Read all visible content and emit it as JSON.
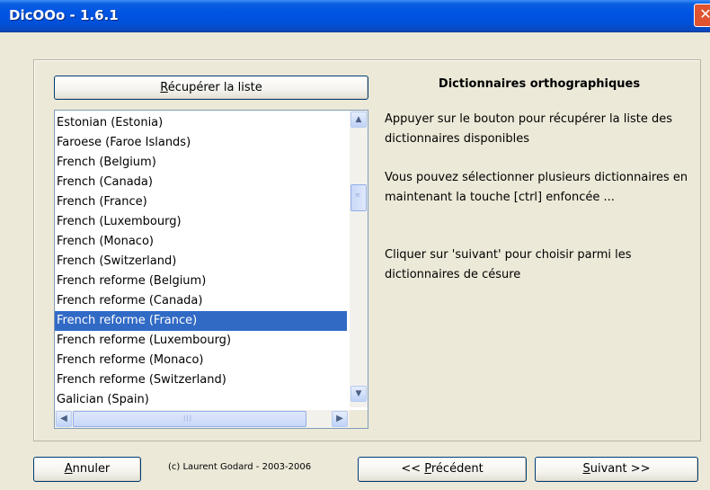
{
  "window": {
    "title": "DicOOo - 1.6.1",
    "close_glyph": "✕"
  },
  "fetch_button": {
    "label_u": "R",
    "label_rest": "écupérer la liste"
  },
  "dictionary_list": {
    "items": [
      "Estonian (Estonia)",
      "Faroese (Faroe Islands)",
      "French (Belgium)",
      "French (Canada)",
      "French (France)",
      "French (Luxembourg)",
      "French (Monaco)",
      "French (Switzerland)",
      "French reforme (Belgium)",
      "French reforme (Canada)",
      "French reforme (France)",
      "French reforme (Luxembourg)",
      "French reforme (Monaco)",
      "French reforme (Switzerland)",
      "Galician (Spain)"
    ],
    "selected_index": 10
  },
  "panel": {
    "title": "Dictionnaires orthographiques",
    "para1": "Appuyer sur le bouton pour récupérer la liste des dictionnaires disponibles",
    "para2": "Vous pouvez sélectionner plusieurs dictionnaires en maintenant la touche [ctrl] enfoncée ...",
    "para3": "Cliquer sur 'suivant' pour choisir parmi les dictionnaires de césure"
  },
  "footer": {
    "cancel_u": "A",
    "cancel_rest": "nnuler",
    "copyright": "(c) Laurent Godard - 2003-2006",
    "prev_pre": "<< ",
    "prev_u": "P",
    "prev_rest": "récédent",
    "next_u": "S",
    "next_rest": "uivant >>"
  },
  "icons": {
    "scroll_up": "▲",
    "scroll_down": "▼",
    "scroll_left": "◀",
    "scroll_right": "▶",
    "grip_v": "≡",
    "grip_h": "|||"
  },
  "colors": {
    "selection": "#316ac5",
    "titlebar": "#0054e3",
    "dialog_bg": "#ece9d8"
  }
}
